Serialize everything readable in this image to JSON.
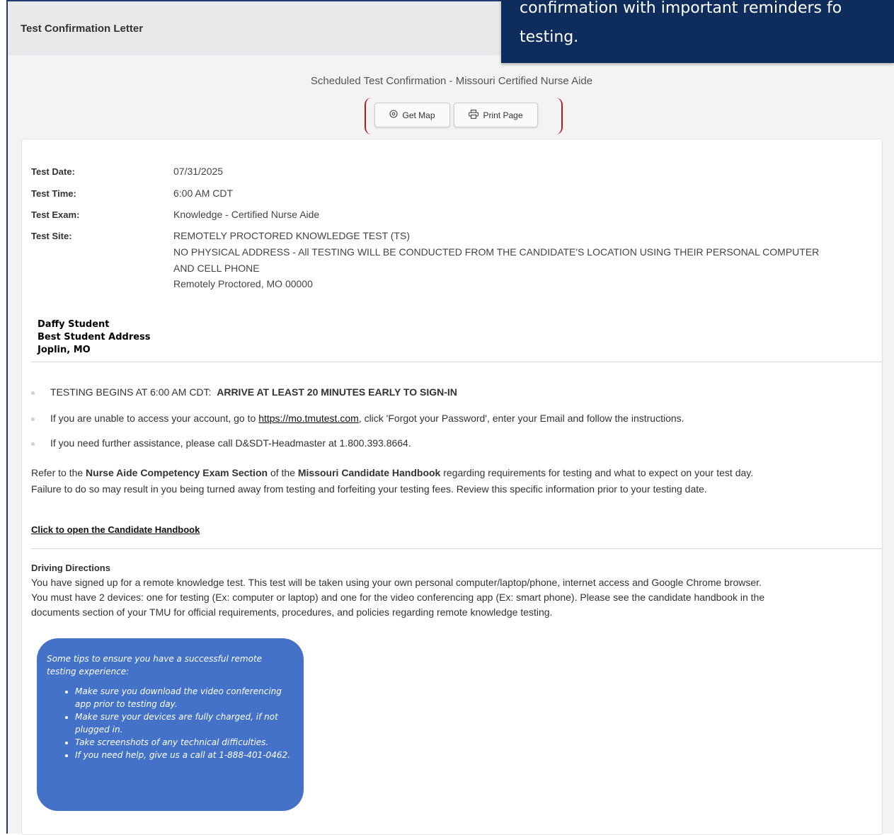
{
  "header": {
    "title": "Test Confirmation Letter"
  },
  "callout": {
    "line1": "confirmation with important reminders fo",
    "line2": "testing."
  },
  "scheduled_title": "Scheduled Test Confirmation - Missouri Certified Nurse Aide",
  "buttons": {
    "get_map": "Get Map",
    "print_page": "Print Page"
  },
  "details": [
    {
      "label": "Test Date:",
      "value": "07/31/2025"
    },
    {
      "label": "Test Time:",
      "value": "6:00 AM CDT"
    },
    {
      "label": "Test Exam:",
      "value": "Knowledge - Certified Nurse Aide"
    },
    {
      "label": "Test Site:",
      "value": "REMOTELY PROCTORED KNOWLEDGE TEST (TS)"
    }
  ],
  "site_lines": [
    "NO PHYSICAL ADDRESS - All TESTING WILL BE CONDUCTED FROM THE CANDIDATE'S LOCATION USING THEIR PERSONAL COMPUTER",
    "AND CELL PHONE",
    "Remotely Proctored, MO 00000"
  ],
  "address": {
    "name": "Daffy Student",
    "street": "Best Student Address",
    "city": "Joplin, MO"
  },
  "bullets": {
    "b1_prefix": "TESTING BEGINS AT 6:00 AM CDT:",
    "b1_bold": "ARRIVE AT LEAST 20 MINUTES EARLY TO SIGN-IN",
    "b2_prefix": "If you are unable to access your account, go to",
    "b2_link": "https://mo.tmutest.com",
    "b2_suffix": ", click 'Forgot your Password', enter your Email and follow the instructions.",
    "b3": "If you need further assistance, please call D&SDT-Headmaster at 1.800.393.8664."
  },
  "refer": {
    "p1": "Refer to the",
    "b1": "Nurse Aide Competency Exam Section",
    "p2": "of the",
    "b2": "Missouri Candidate Handbook",
    "p3": "regarding requirements for testing and what to expect on your test day.",
    "line2": "Failure to do so may result in you being turned away from testing and forfeiting your testing fees.  Review this specific information prior to your testing date."
  },
  "handbook_link": "Click to open the Candidate Handbook",
  "directions": {
    "title": "Driving Directions",
    "line1": "You have signed up for a remote knowledge test. This test will be taken using your own personal computer/laptop/phone, internet access and Google Chrome browser.",
    "line2": "You must have 2 devices: one for testing (Ex: computer or laptop) and one for the video conferencing app (Ex: smart phone). Please see the candidate handbook in the",
    "line3": "documents section of your TMU for official requirements, procedures, and policies regarding remote knowledge testing."
  },
  "tips": {
    "heading": "Some tips to ensure you have a successful remote testing experience:",
    "items": [
      "Make sure you download the video conferencing app prior to testing day.",
      "Make sure your devices are fully charged, if not plugged in.",
      "Take screenshots of any technical difficulties.",
      "If you need help, give us a call at 1-888-401-0462."
    ]
  },
  "colors": {
    "callout_bg": "#0f2d5c",
    "tips_bg": "#4372c8",
    "bracket": "#b11c1c"
  }
}
